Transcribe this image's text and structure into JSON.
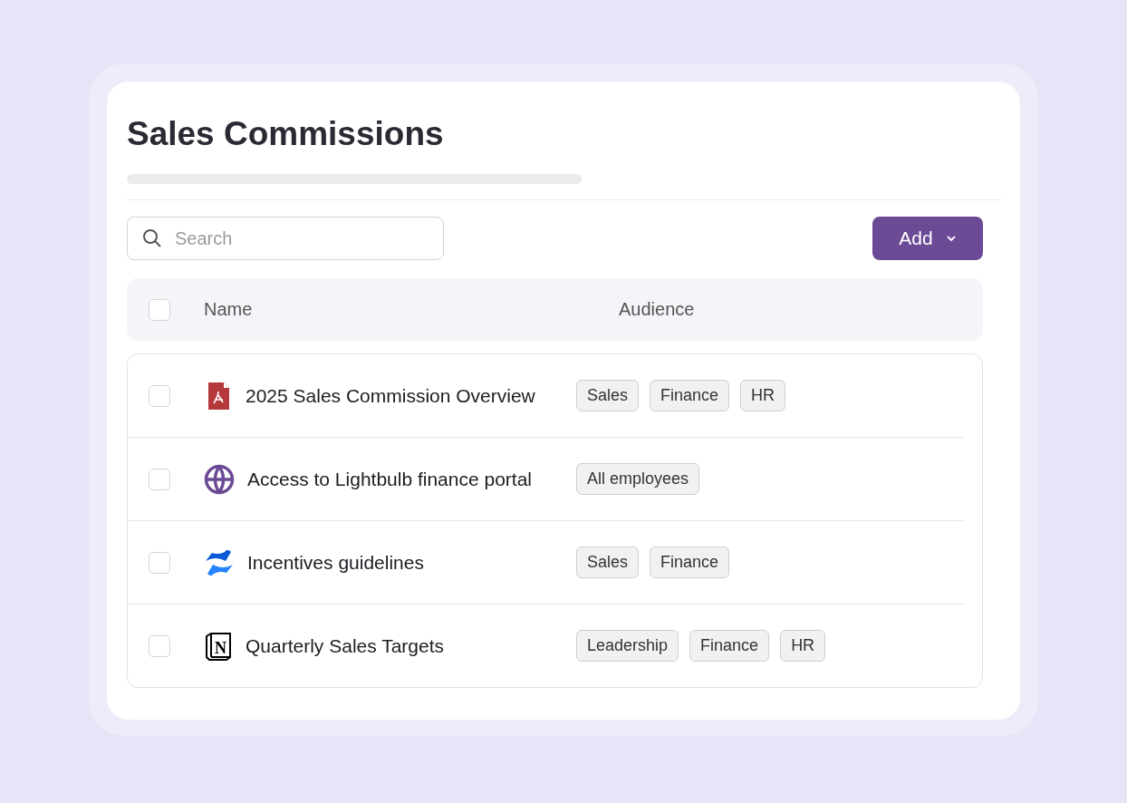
{
  "title": "Sales Commissions",
  "search": {
    "placeholder": "Search"
  },
  "add_button": {
    "label": "Add"
  },
  "table": {
    "select_all": {
      "checked": false
    },
    "columns": [
      "Name",
      "Audience"
    ],
    "rows": [
      {
        "kind": "pdf",
        "name": "2025 Sales Commission Overview",
        "checked": false,
        "audience": [
          "Sales",
          "Finance",
          "HR"
        ]
      },
      {
        "kind": "web",
        "name": "Access to Lightbulb finance portal",
        "checked": false,
        "audience": [
          "All employees"
        ]
      },
      {
        "kind": "confluence",
        "name": "Incentives guidelines",
        "checked": false,
        "audience": [
          "Sales",
          "Finance"
        ]
      },
      {
        "kind": "notion",
        "icon_letter": "N",
        "name": "Quarterly Sales Targets",
        "checked": false,
        "audience": [
          "Leadership",
          "Finance",
          "HR"
        ]
      }
    ]
  }
}
